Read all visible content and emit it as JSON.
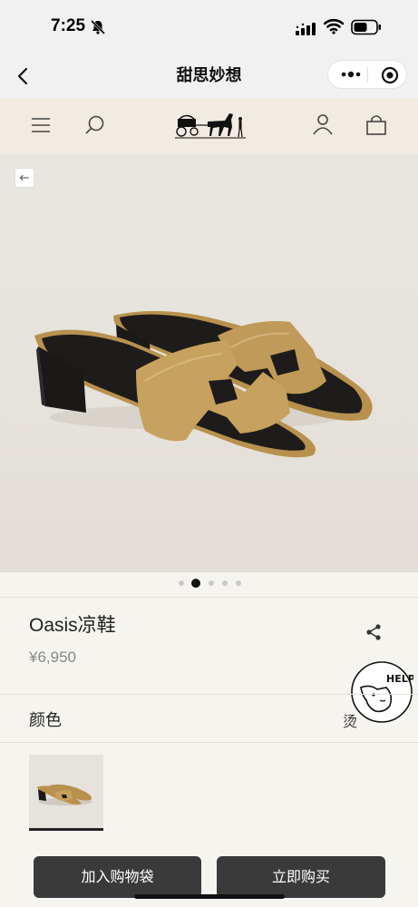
{
  "status_bar": {
    "time": "7:25",
    "icons": [
      "bell-slash-icon",
      "signal-icon",
      "wifi-icon",
      "battery-icon"
    ]
  },
  "miniprogram_nav": {
    "title": "甜思妙想",
    "icons": [
      "back-arrow-icon",
      "more-dots-icon",
      "close-target-icon"
    ]
  },
  "shop_header": {
    "icons": [
      "menu-icon",
      "search-icon",
      "brand-logo-carriage",
      "account-icon",
      "shopping-bag-icon"
    ]
  },
  "gallery": {
    "image": "product-sandal-image",
    "back_icon": "small-left-arrow-icon",
    "page_count": 5,
    "active_index": 1
  },
  "product": {
    "name": "Oasis凉鞋",
    "price": "¥6,950",
    "share_icon": "share-icon"
  },
  "help_badge": {
    "text": "HELP"
  },
  "color": {
    "label": "颜色",
    "selected_text": "烫"
  },
  "actions": {
    "add_to_bag": "加入购物袋",
    "buy_now": "立即购买"
  },
  "colors": {
    "page_bg": "#f6f4ef",
    "header_bg": "#f1ebe1",
    "button_bg": "#3a3a3a",
    "sandal_gold": "#b8914e"
  }
}
